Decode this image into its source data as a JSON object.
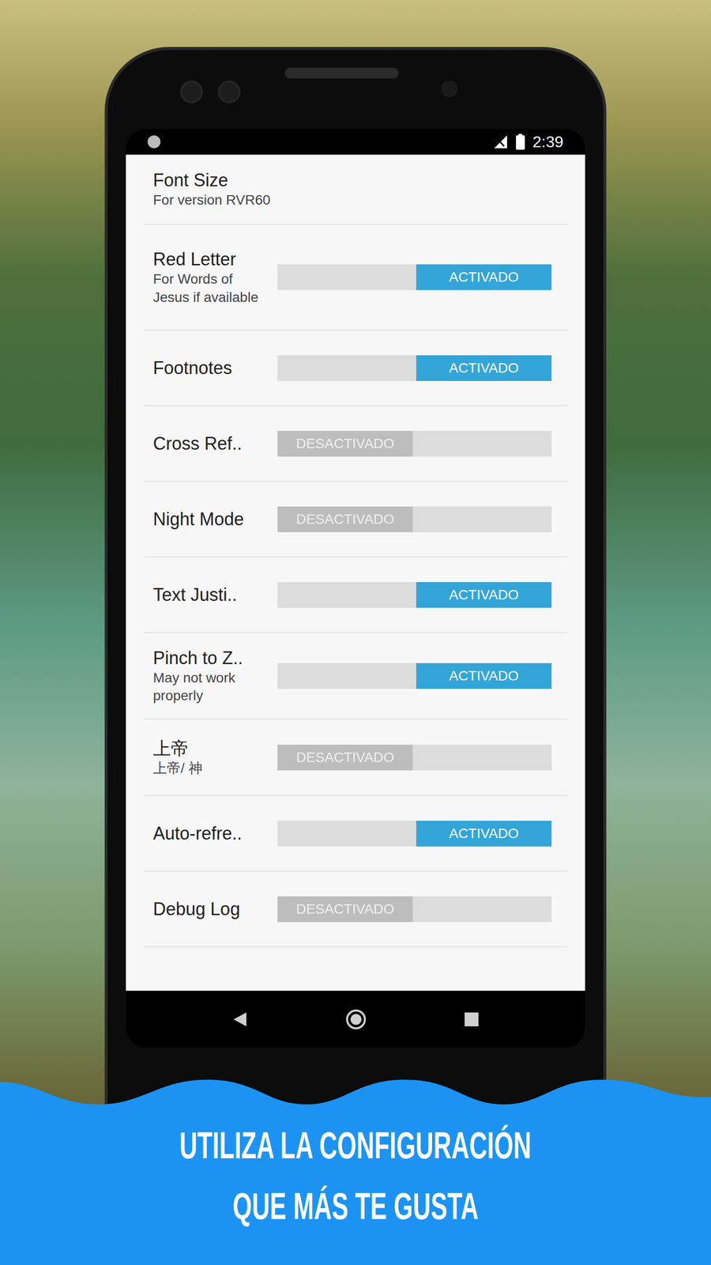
{
  "status_bar": {
    "time": "2:39"
  },
  "settings": [
    {
      "label": "Font Size",
      "subtitle": "For version RVR60",
      "kind": "text"
    },
    {
      "label": "Red Letter",
      "subtitle": "For Words of Jesus if available",
      "kind": "toggle",
      "on": true,
      "state_label": "ACTIVADO"
    },
    {
      "label": "Footnotes",
      "subtitle": "",
      "kind": "toggle",
      "on": true,
      "state_label": "ACTIVADO"
    },
    {
      "label": "Cross Ref..",
      "subtitle": "",
      "kind": "toggle",
      "on": false,
      "state_label": "DESACTIVADO"
    },
    {
      "label": "Night Mode",
      "subtitle": "",
      "kind": "toggle",
      "on": false,
      "state_label": "DESACTIVADO"
    },
    {
      "label": "Text Justi..",
      "subtitle": "",
      "kind": "toggle",
      "on": true,
      "state_label": "ACTIVADO"
    },
    {
      "label": "Pinch to Z..",
      "subtitle": "May not work properly",
      "kind": "toggle",
      "on": true,
      "state_label": "ACTIVADO"
    },
    {
      "label": "上帝",
      "subtitle": "上帝/ 神",
      "kind": "toggle",
      "on": false,
      "state_label": "DESACTIVADO"
    },
    {
      "label": "Auto-refre..",
      "subtitle": "",
      "kind": "toggle",
      "on": true,
      "state_label": "ACTIVADO"
    },
    {
      "label": "Debug Log",
      "subtitle": "",
      "kind": "toggle",
      "on": false,
      "state_label": "DESACTIVADO"
    }
  ],
  "caption": [
    "UTILIZA LA CONFIGURACIÓN",
    "QUE MÁS TE GUSTA"
  ]
}
